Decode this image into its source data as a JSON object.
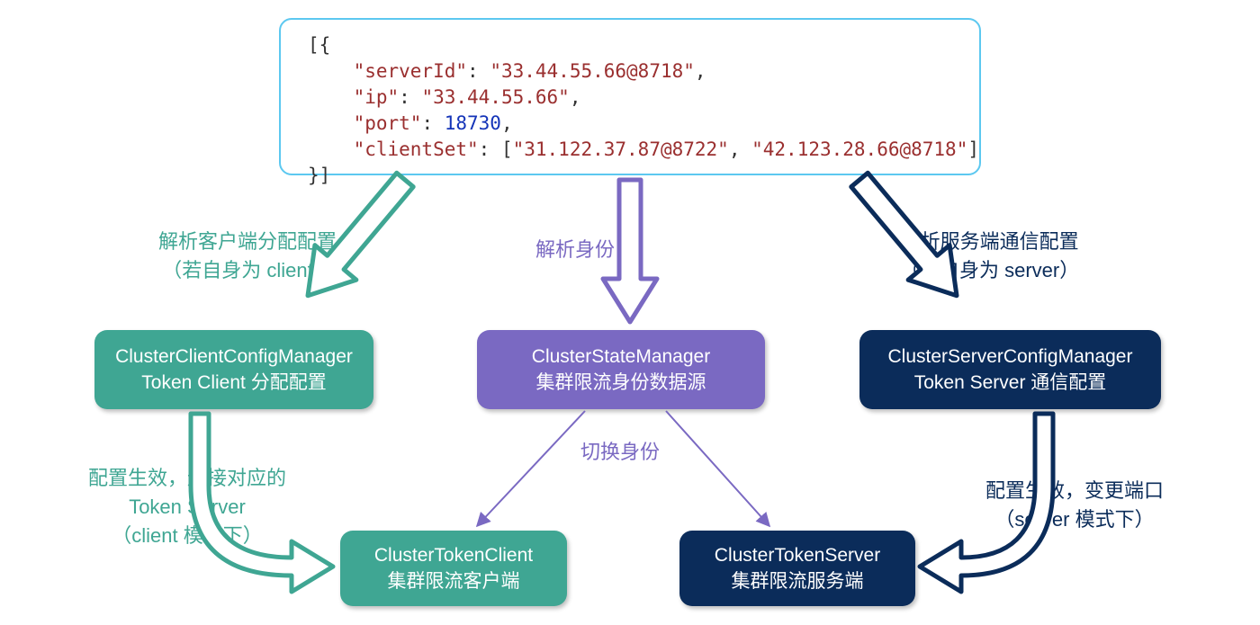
{
  "config": {
    "open": "[{",
    "serverId_key": "\"serverId\"",
    "serverId_val": "\"33.44.55.66@8718\"",
    "ip_key": "\"ip\"",
    "ip_val": "\"33.44.55.66\"",
    "port_key": "\"port\"",
    "port_val": "18730",
    "clientSet_key": "\"clientSet\"",
    "clientSet_open": "[",
    "clientSet_v1": "\"31.122.37.87@8722\"",
    "clientSet_v2": "\"42.123.28.66@8718\"",
    "clientSet_close": "]",
    "close": "}]"
  },
  "nodes": {
    "ccm_line1": "ClusterClientConfigManager",
    "ccm_line2": "Token Client 分配配置",
    "csm_line1": "ClusterStateManager",
    "csm_line2": "集群限流身份数据源",
    "scm_line1": "ClusterServerConfigManager",
    "scm_line2": "Token Server 通信配置",
    "ctc_line1": "ClusterTokenClient",
    "ctc_line2": "集群限流客户端",
    "cts_line1": "ClusterTokenServer",
    "cts_line2": "集群限流服务端"
  },
  "labels": {
    "left_top_1": "解析客户端分配配置",
    "left_top_2": "（若自身为 client）",
    "mid_top": "解析身份",
    "right_top_1": "解析服务端通信配置",
    "right_top_2": "（若自身为 server）",
    "switch": "切换身份",
    "left_bot_1": "配置生效，连接对应的",
    "left_bot_2": "Token Server",
    "left_bot_3": "（client 模式下）",
    "right_bot_1": "配置生效，变更端口",
    "right_bot_2": "（server 模式下）"
  },
  "colors": {
    "teal": "#3fa693",
    "purple": "#7a69c2",
    "navy": "#0b2c5a",
    "border": "#5cc8f0"
  }
}
